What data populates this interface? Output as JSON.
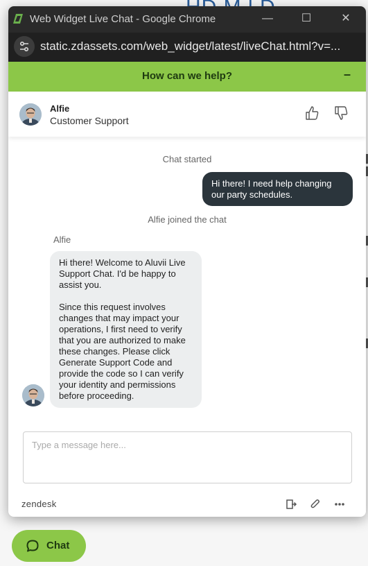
{
  "browser": {
    "window_title": "Web Widget Live Chat - Google Chrome",
    "url": "static.zdassets.com/web_widget/latest/liveChat.html?v=...",
    "minimize_symbol": "—",
    "maximize_symbol": "☐",
    "close_symbol": "✕"
  },
  "widget": {
    "header_title": "How can we help?",
    "minimize_symbol": "–",
    "agent": {
      "name": "Alfie",
      "role": "Customer Support"
    },
    "messages": {
      "chat_started": "Chat started",
      "user_message": "Hi there! I need help changing our party schedules.",
      "agent_joined": "Alfie joined the chat",
      "agent_label": "Alfie",
      "agent_paragraph_1": "Hi there! Welcome to Aluvii Live Support Chat. I'd be happy to assist you.",
      "agent_paragraph_2": "Since this request involves changes that may impact your operations, I first need to verify that you are authorized to make these changes. Please click Generate Support Code and provide the code so I can verify your identity and permissions before proceeding."
    },
    "composer": {
      "placeholder": "Type a message here...",
      "value": ""
    },
    "footer": {
      "brand": "zendesk"
    }
  },
  "launcher": {
    "label": "Chat"
  },
  "colors": {
    "accent_green": "#8cc748",
    "dark_text_on_green": "#1e3a10",
    "user_bubble": "#2b353c",
    "agent_bubble": "#eceeef"
  },
  "icons": [
    "app-icon",
    "site-info-icon",
    "minimize-icon",
    "thumbs-up-icon",
    "thumbs-down-icon",
    "end-chat-icon",
    "attachment-icon",
    "more-icon",
    "chat-bubble-icon"
  ]
}
